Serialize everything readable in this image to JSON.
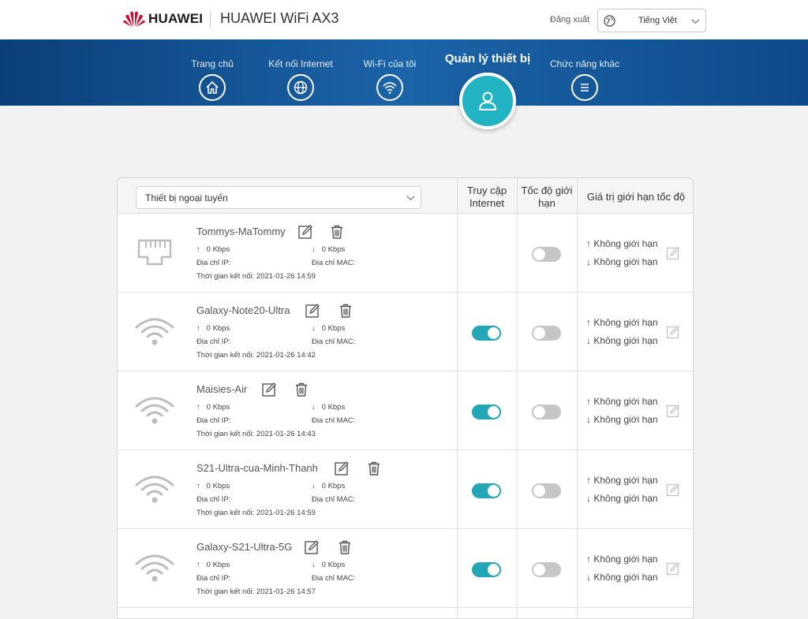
{
  "header": {
    "brand": "HUAWEI",
    "product": "HUAWEI WiFi AX3",
    "logout": "Đăng xuất",
    "language": "Tiếng Việt"
  },
  "nav": {
    "items": [
      {
        "label": "Trang chủ",
        "icon": "home-icon"
      },
      {
        "label": "Kết nối Internet",
        "icon": "globe-icon"
      },
      {
        "label": "Wi-Fi của tôi",
        "icon": "wifi-icon"
      },
      {
        "label": "Quản lý thiết bị",
        "icon": "user-icon",
        "active": true
      },
      {
        "label": "Chức năng khác",
        "icon": "menu-icon"
      }
    ]
  },
  "table": {
    "filter": "Thiết bị ngoại tuyến",
    "columns": {
      "internet": "Truy cập Internet",
      "speed_limit": "Tốc độ giới hạn",
      "limit_value": "Giá trị giới hạn tốc độ"
    },
    "labels": {
      "ip": "Địa chỉ IP:",
      "mac": "Địa chỉ MAC:",
      "no_limit": "Không giới hạn"
    },
    "devices": [
      {
        "name": "Tommys-MaTommy",
        "type": "ethernet",
        "up": "0 Kbps",
        "down": "0 Kbps",
        "connected": "Thời gian kết nối: 2021-01-26 14:59",
        "internet": null,
        "speed_limit": false
      },
      {
        "name": "Galaxy-Note20-Ultra",
        "type": "wifi",
        "up": "0 Kbps",
        "down": "0 Kbps",
        "connected": "Thời gian kết nối: 2021-01-26 14:42",
        "internet": true,
        "speed_limit": false
      },
      {
        "name": "Maisies-Air",
        "type": "wifi",
        "up": "0 Kbps",
        "down": "0 Kbps",
        "connected": "Thời gian kết nối: 2021-01-26 14:43",
        "internet": true,
        "speed_limit": false
      },
      {
        "name": "S21-Ultra-cua-Minh-Thanh",
        "type": "wifi",
        "up": "0 Kbps",
        "down": "0 Kbps",
        "connected": "Thời gian kết nối: 2021-01-26 14:59",
        "internet": true,
        "speed_limit": false
      },
      {
        "name": "Galaxy-S21-Ultra-5G",
        "type": "wifi",
        "up": "0 Kbps",
        "down": "0 Kbps",
        "connected": "Thời gian kết nối: 2021-01-26 14:57",
        "internet": true,
        "speed_limit": false
      }
    ]
  },
  "colors": {
    "accent": "#23a6b5",
    "nav_blue": "#1b64a8",
    "brand_red": "#cf0a2c"
  }
}
